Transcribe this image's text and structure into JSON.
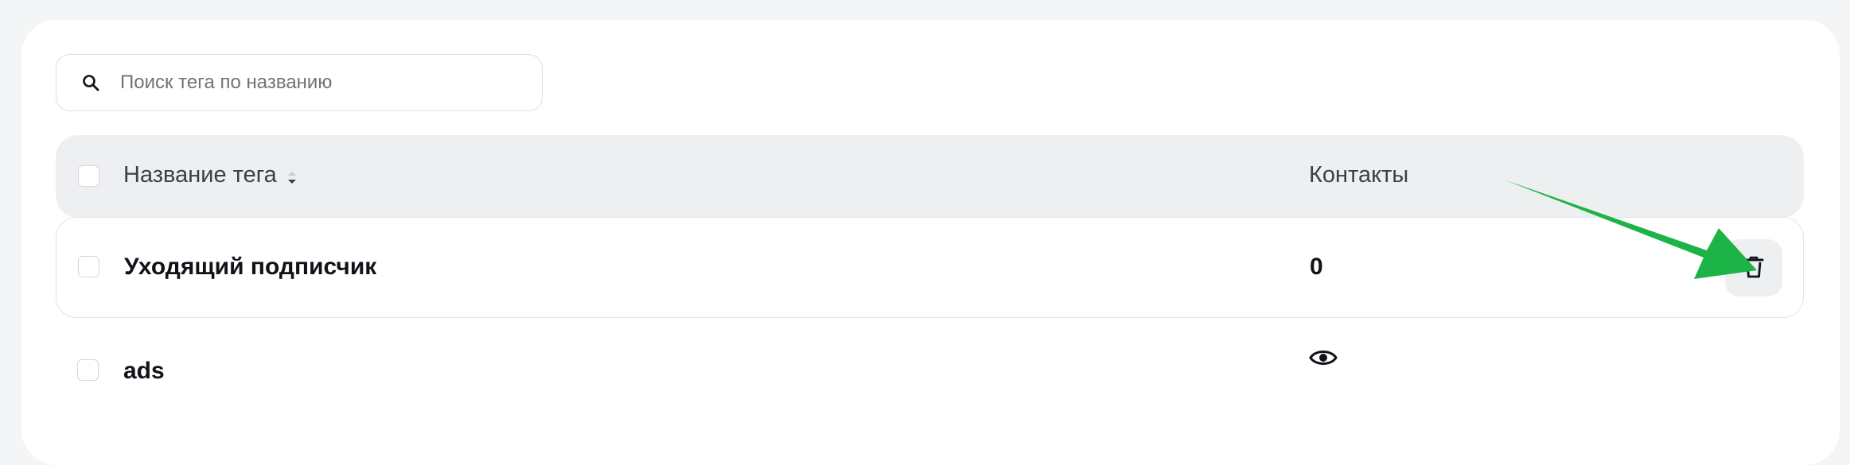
{
  "search": {
    "placeholder": "Поиск тега по названию",
    "value": ""
  },
  "table": {
    "columns": {
      "name": "Название тега",
      "contacts": "Контакты"
    },
    "rows": [
      {
        "name": "Уходящий подписчик",
        "contacts": "0"
      },
      {
        "name": "ads",
        "contacts": ""
      }
    ]
  },
  "icons": {
    "search": "search-icon",
    "sort": "sort-desc-icon",
    "trash": "trash-icon",
    "eye": "eye-icon",
    "annotation": "green-arrow"
  },
  "colors": {
    "header_bg": "#eeeff1",
    "text": "#111318",
    "annotation_arrow": "#1db447"
  }
}
